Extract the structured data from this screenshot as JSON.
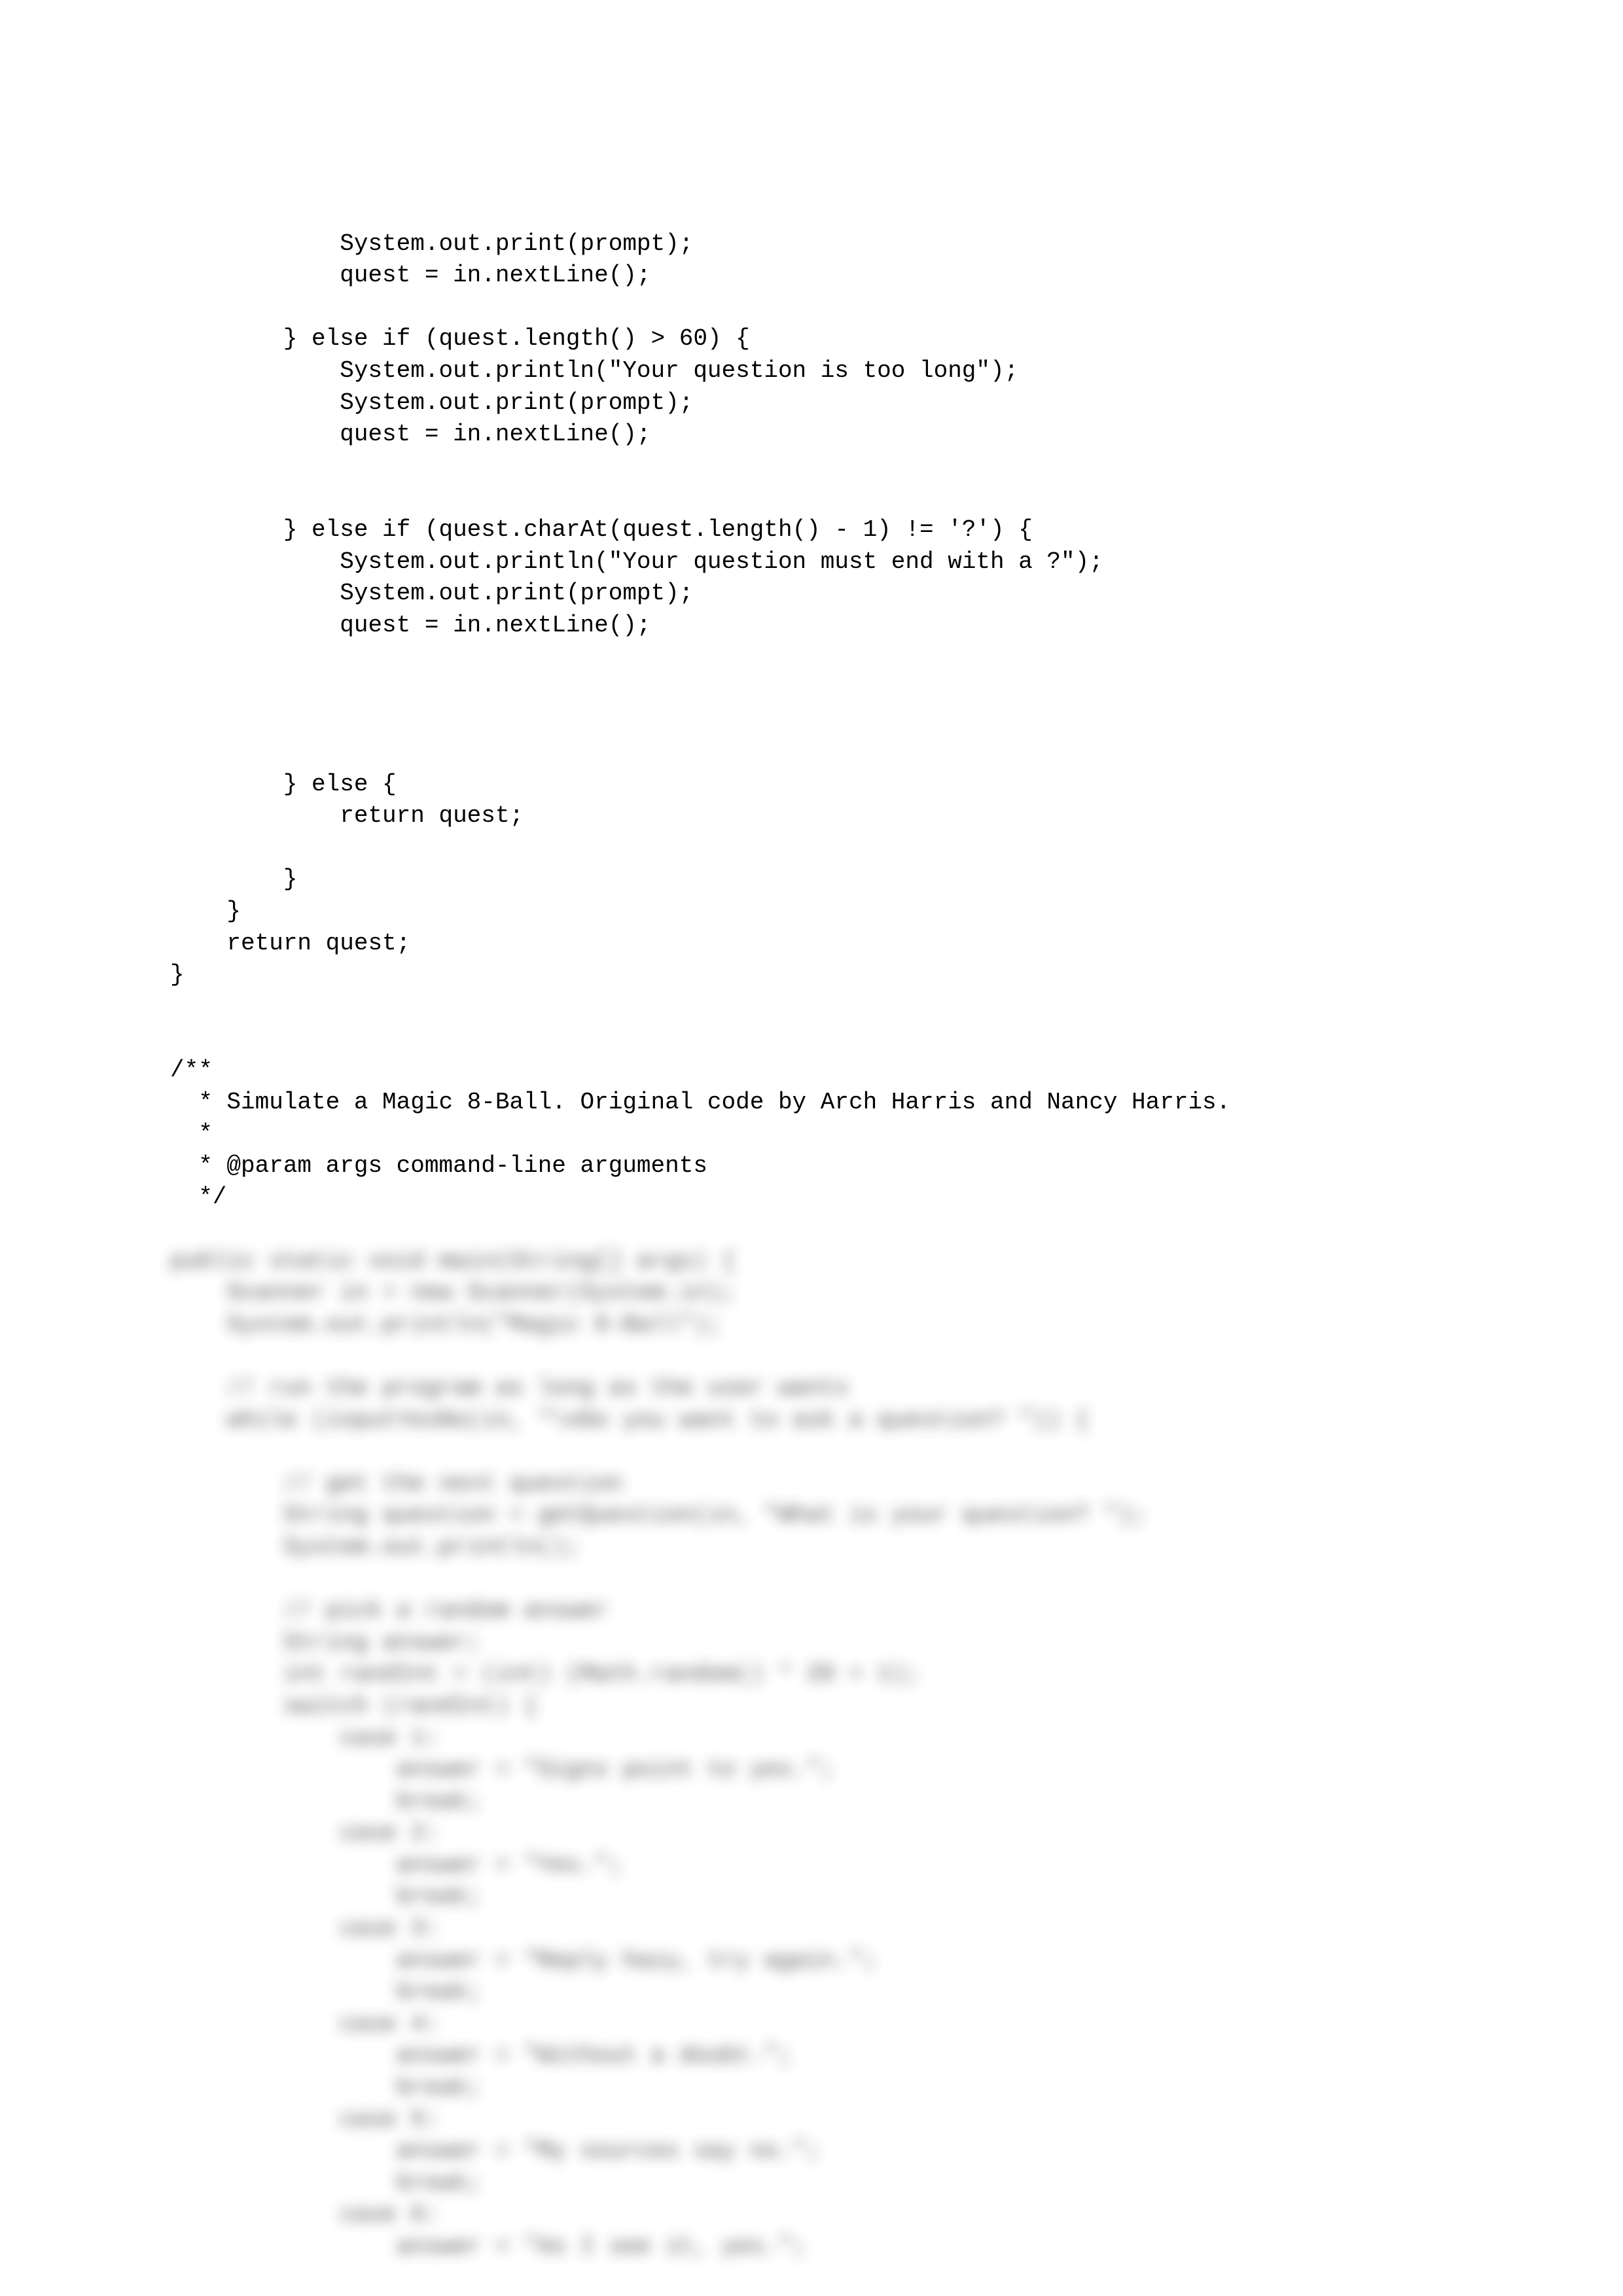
{
  "code": {
    "lines": [
      "            System.out.print(prompt);",
      "            quest = in.nextLine();",
      "",
      "        } else if (quest.length() > 60) {",
      "            System.out.println(\"Your question is too long\");",
      "            System.out.print(prompt);",
      "            quest = in.nextLine();",
      "",
      "",
      "        } else if (quest.charAt(quest.length() - 1) != '?') {",
      "            System.out.println(\"Your question must end with a ?\");",
      "            System.out.print(prompt);",
      "            quest = in.nextLine();",
      "",
      "",
      "",
      "",
      "        } else {",
      "            return quest;",
      "",
      "        }",
      "    }",
      "    return quest;",
      "}",
      "",
      "",
      "/**",
      "  * Simulate a Magic 8-Ball. Original code by Arch Harris and Nancy Harris.",
      "  *",
      "  * @param args command-line arguments",
      "  */"
    ]
  },
  "blurred": {
    "lines": [
      "public static void main(String[] args) {",
      "    Scanner in = new Scanner(System.in);",
      "    System.out.println(\"Magic 8-Ball\");",
      "",
      "    // run the program as long as the user wants",
      "    while (inputYesNo(in, \"\\nDo you want to ask a question? \")) {",
      "",
      "        // get the next question",
      "        String question = getQuestion(in, \"What is your question? \");",
      "        System.out.println();",
      "",
      "        // pick a random answer",
      "        String answer;",
      "        int randInt = (int) (Math.random() * 20 + 1);",
      "        switch (randInt) {",
      "            case 1:",
      "                answer = \"Signs point to yes.\";",
      "                break;",
      "            case 2:",
      "                answer = \"Yes.\";",
      "                break;",
      "            case 3:",
      "                answer = \"Reply hazy, try again.\";",
      "                break;",
      "            case 4:",
      "                answer = \"Without a doubt.\";",
      "                break;",
      "            case 5:",
      "                answer = \"My sources say no.\";",
      "                break;",
      "            case 6:",
      "                answer = \"As I see it, yes.\";"
    ]
  }
}
